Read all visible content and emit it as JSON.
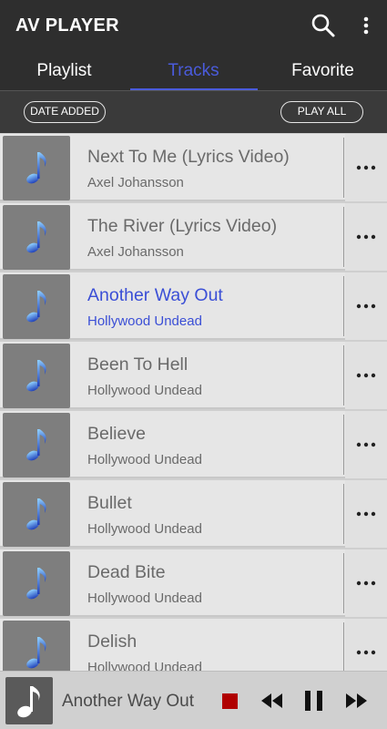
{
  "appbar": {
    "title": "AV PLAYER",
    "search_icon": "search-icon",
    "menu_icon": "more-vert-icon"
  },
  "tabs": [
    {
      "label": "Playlist",
      "active": false
    },
    {
      "label": "Tracks",
      "active": true
    },
    {
      "label": "Favorite",
      "active": false
    }
  ],
  "toolbar": {
    "sort_label": "DATE ADDED",
    "play_all_label": "PLAY ALL"
  },
  "tracks": [
    {
      "title": "Next To Me (Lyrics Video)",
      "artist": "Axel Johansson",
      "active": false
    },
    {
      "title": "The River (Lyrics Video)",
      "artist": "Axel Johansson",
      "active": false
    },
    {
      "title": "Another Way Out",
      "artist": "Hollywood Undead",
      "active": true
    },
    {
      "title": "Been To Hell",
      "artist": "Hollywood Undead",
      "active": false
    },
    {
      "title": "Believe",
      "artist": "Hollywood Undead",
      "active": false
    },
    {
      "title": "Bullet",
      "artist": "Hollywood Undead",
      "active": false
    },
    {
      "title": "Dead Bite",
      "artist": "Hollywood Undead",
      "active": false
    },
    {
      "title": "Delish",
      "artist": "Hollywood Undead",
      "active": false
    }
  ],
  "player": {
    "now_playing": "Another Way Out",
    "stop_icon": "stop-icon",
    "rewind_icon": "rewind-icon",
    "pause_icon": "pause-icon",
    "forward_icon": "fast-forward-icon"
  },
  "colors": {
    "accent": "#4a5bdb",
    "active_text": "#3b4fd6",
    "bar": "#2e2e2e",
    "stop": "#b00000"
  }
}
